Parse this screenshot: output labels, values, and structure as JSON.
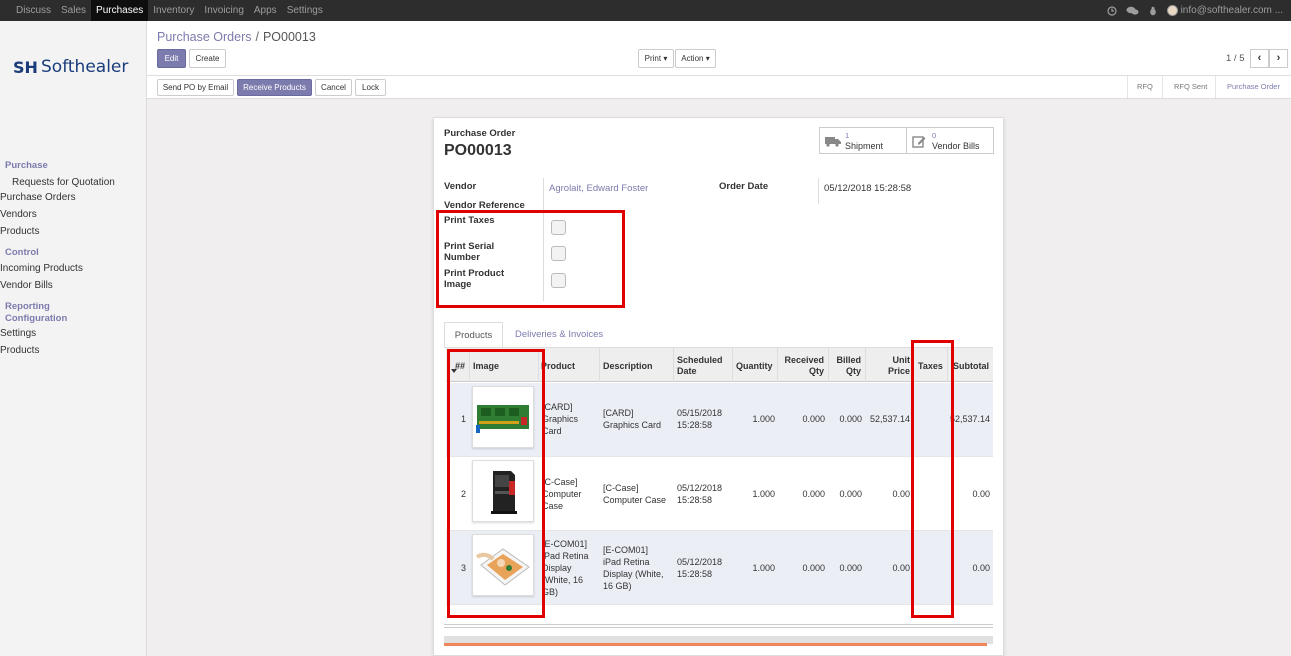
{
  "navbar": {
    "menu": [
      "Discuss",
      "Sales",
      "Purchases",
      "Inventory",
      "Invoicing",
      "Apps",
      "Settings"
    ],
    "active_menu": "Purchases",
    "user_email": "info@softhealer.com ..."
  },
  "logo": {
    "mark": "SH",
    "word": "Softhealer"
  },
  "sidebar": {
    "section_purchase": "Purchase",
    "purchase_items": [
      "Requests for Quotation",
      "Purchase Orders",
      "Vendors",
      "Products"
    ],
    "active_item": "Purchase Orders",
    "section_control": "Control",
    "control_items": [
      "Incoming Products",
      "Vendor Bills"
    ],
    "section_reporting": "Reporting",
    "section_configuration": "Configuration",
    "configuration_items": [
      "Settings",
      "Products"
    ]
  },
  "breadcrumb": {
    "parent": "Purchase Orders",
    "separator": "/",
    "current": "PO00013"
  },
  "toolbar": {
    "edit": "Edit",
    "create": "Create",
    "print": "Print ▾",
    "action": "Action ▾",
    "pager": "1 / 5",
    "prev": "‹",
    "next": "›"
  },
  "actions": {
    "send_po": "Send PO by Email",
    "receive": "Receive Products",
    "cancel": "Cancel",
    "lock": "Lock"
  },
  "statusbar": [
    "RFQ",
    "RFQ Sent",
    "Purchase Order"
  ],
  "status_active": "Purchase Order",
  "form": {
    "doc_type": "Purchase Order",
    "doc_number": "PO00013",
    "smart_buttons": [
      {
        "count": "1",
        "label": "Shipment",
        "icon": "truck-icon"
      },
      {
        "count": "0",
        "label": "Vendor Bills",
        "icon": "pencil-square-icon"
      }
    ],
    "vendor_label": "Vendor",
    "vendor_value": "Agrolait, Edward Foster",
    "vendor_ref_label": "Vendor Reference",
    "order_date_label": "Order Date",
    "order_date_value": "05/12/2018 15:28:58",
    "print_taxes_label": "Print Taxes",
    "print_serial_label_1": "Print Serial",
    "print_serial_label_2": "Number",
    "print_image_label_1": "Print Product",
    "print_image_label_2": "Image"
  },
  "tabs": [
    "Products",
    "Deliveries & Invoices"
  ],
  "table": {
    "headers": {
      "num": "##",
      "image": "Image",
      "product": "Product",
      "description": "Description",
      "scheduled_1": "Scheduled",
      "scheduled_2": "Date",
      "quantity": "Quantity",
      "received_1": "Received",
      "received_2": "Qty",
      "billed_1": "Billed",
      "billed_2": "Qty",
      "unit_1": "Unit",
      "unit_2": "Price",
      "taxes": "Taxes",
      "subtotal": "Subtotal"
    },
    "rows": [
      {
        "num": "1",
        "image": "graphics-card-image",
        "product": [
          "[CARD]",
          "Graphics",
          "Card"
        ],
        "description": [
          "[CARD]",
          "Graphics Card"
        ],
        "date": [
          "05/15/2018",
          "15:28:58"
        ],
        "quantity": "1.000",
        "received": "0.000",
        "billed": "0.000",
        "unit_price": "52,537.14",
        "taxes": "",
        "subtotal": "52,537.14"
      },
      {
        "num": "2",
        "image": "computer-case-image",
        "product": [
          "[C-Case]",
          "Computer",
          "Case"
        ],
        "description": [
          "[C-Case]",
          "Computer Case"
        ],
        "date": [
          "05/12/2018",
          "15:28:58"
        ],
        "quantity": "1.000",
        "received": "0.000",
        "billed": "0.000",
        "unit_price": "0.00",
        "taxes": "",
        "subtotal": "0.00"
      },
      {
        "num": "3",
        "image": "ipad-image",
        "product": [
          "[E-COM01]",
          "iPad Retina",
          "Display",
          "(White, 16",
          "GB)"
        ],
        "description": [
          "[E-COM01]",
          "iPad Retina",
          "Display (White,",
          "16 GB)"
        ],
        "date": [
          "05/12/2018",
          "15:28:58"
        ],
        "quantity": "1.000",
        "received": "0.000",
        "billed": "0.000",
        "unit_price": "0.00",
        "taxes": "",
        "subtotal": "0.00"
      }
    ]
  },
  "colors": {
    "accent": "#7c7bad",
    "highlight": "#e00000",
    "navbar": "#2d2d2d"
  }
}
